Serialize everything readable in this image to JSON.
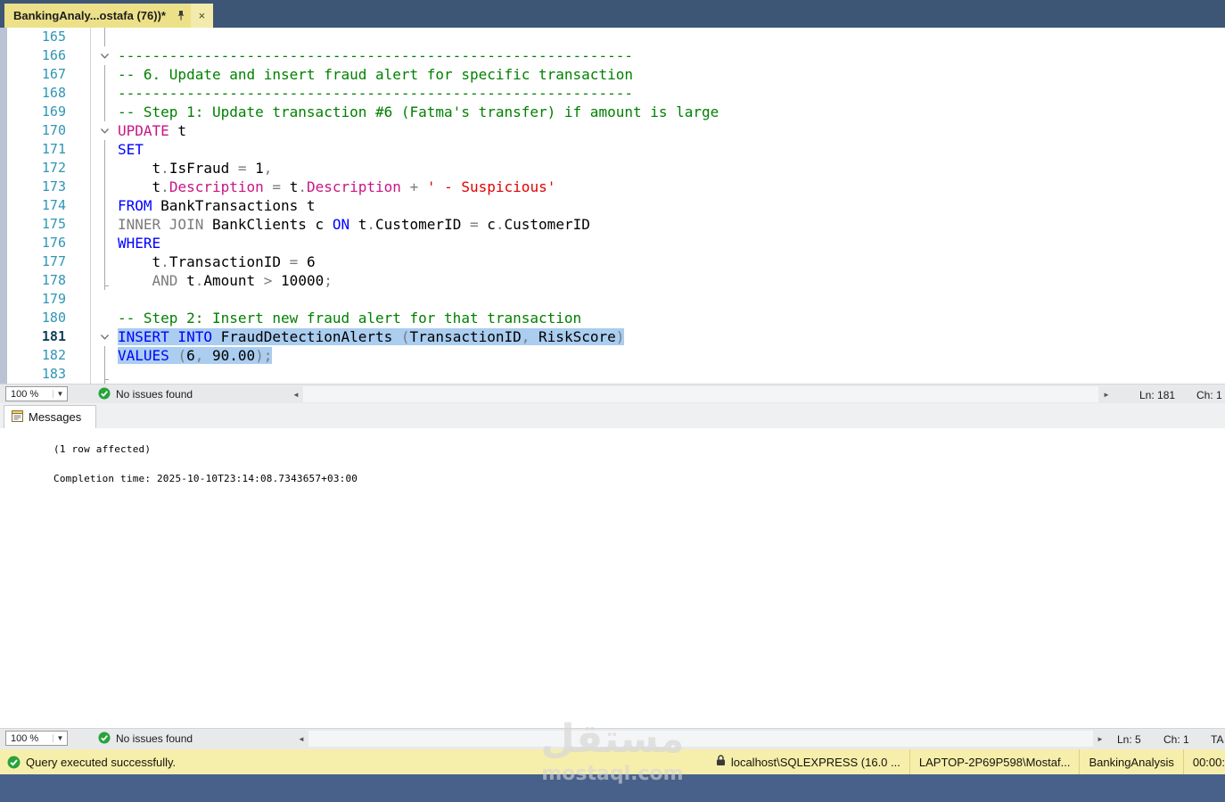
{
  "tab": {
    "title": "BankingAnaly...ostafa (76))*"
  },
  "editor": {
    "status": {
      "zoom": "100 %",
      "issues": "No issues found",
      "ln": "Ln: 181",
      "ch": "Ch: 1"
    },
    "lines": [
      {
        "n": 165,
        "fold": "guide",
        "tokens": []
      },
      {
        "n": 166,
        "fold": "open",
        "tokens": [
          {
            "c": "cm",
            "t": "------------------------------------------------------------"
          }
        ]
      },
      {
        "n": 167,
        "fold": "guide",
        "tokens": [
          {
            "c": "cm",
            "t": "-- 6. Update and insert fraud alert for specific transaction"
          }
        ]
      },
      {
        "n": 168,
        "fold": "guide",
        "tokens": [
          {
            "c": "cm",
            "t": "------------------------------------------------------------"
          }
        ]
      },
      {
        "n": 169,
        "fold": "guide",
        "tokens": [
          {
            "c": "cm",
            "t": "-- Step 1: Update transaction #6 (Fatma's transfer) if amount is large"
          }
        ]
      },
      {
        "n": 170,
        "fold": "open",
        "tokens": [
          {
            "c": "fn",
            "t": "UPDATE"
          },
          {
            "c": "id",
            "t": " t"
          }
        ]
      },
      {
        "n": 171,
        "fold": "guide",
        "tokens": [
          {
            "c": "kw",
            "t": "SET"
          }
        ]
      },
      {
        "n": 172,
        "fold": "guide",
        "tokens": [
          {
            "c": "id",
            "t": "    t"
          },
          {
            "c": "op",
            "t": "."
          },
          {
            "c": "id",
            "t": "IsFraud "
          },
          {
            "c": "op",
            "t": "= "
          },
          {
            "c": "id",
            "t": "1"
          },
          {
            "c": "op",
            "t": ","
          }
        ]
      },
      {
        "n": 173,
        "fold": "guide",
        "tokens": [
          {
            "c": "id",
            "t": "    t"
          },
          {
            "c": "op",
            "t": "."
          },
          {
            "c": "fn",
            "t": "Description"
          },
          {
            "c": "op",
            "t": " = "
          },
          {
            "c": "id",
            "t": "t"
          },
          {
            "c": "op",
            "t": "."
          },
          {
            "c": "fn",
            "t": "Description"
          },
          {
            "c": "op",
            "t": " + "
          },
          {
            "c": "st",
            "t": "' - Suspicious'"
          }
        ]
      },
      {
        "n": 174,
        "fold": "guide",
        "tokens": [
          {
            "c": "kw",
            "t": "FROM"
          },
          {
            "c": "id",
            "t": " BankTransactions t"
          }
        ]
      },
      {
        "n": 175,
        "fold": "guide",
        "tokens": [
          {
            "c": "op",
            "t": "INNER JOIN"
          },
          {
            "c": "id",
            "t": " BankClients c "
          },
          {
            "c": "kw",
            "t": "ON"
          },
          {
            "c": "id",
            "t": " t"
          },
          {
            "c": "op",
            "t": "."
          },
          {
            "c": "id",
            "t": "CustomerID "
          },
          {
            "c": "op",
            "t": "= "
          },
          {
            "c": "id",
            "t": "c"
          },
          {
            "c": "op",
            "t": "."
          },
          {
            "c": "id",
            "t": "CustomerID"
          }
        ]
      },
      {
        "n": 176,
        "fold": "guide",
        "tokens": [
          {
            "c": "kw",
            "t": "WHERE"
          }
        ]
      },
      {
        "n": 177,
        "fold": "guide",
        "tokens": [
          {
            "c": "id",
            "t": "    t"
          },
          {
            "c": "op",
            "t": "."
          },
          {
            "c": "id",
            "t": "TransactionID "
          },
          {
            "c": "op",
            "t": "= "
          },
          {
            "c": "id",
            "t": "6"
          }
        ]
      },
      {
        "n": 178,
        "fold": "end",
        "tokens": [
          {
            "c": "op",
            "t": "    AND"
          },
          {
            "c": "id",
            "t": " t"
          },
          {
            "c": "op",
            "t": "."
          },
          {
            "c": "id",
            "t": "Amount "
          },
          {
            "c": "op",
            "t": "> "
          },
          {
            "c": "id",
            "t": "10000"
          },
          {
            "c": "op",
            "t": ";"
          }
        ]
      },
      {
        "n": 179,
        "fold": "",
        "tokens": []
      },
      {
        "n": 180,
        "fold": "",
        "tokens": [
          {
            "c": "cm",
            "t": "-- Step 2: Insert new fraud alert for that transaction"
          }
        ]
      },
      {
        "n": 181,
        "fold": "open",
        "cur": true,
        "sel": true,
        "tokens": [
          {
            "c": "kw",
            "t": "INSERT INTO"
          },
          {
            "c": "id",
            "t": " FraudDetectionAlerts "
          },
          {
            "c": "op",
            "t": "("
          },
          {
            "c": "id",
            "t": "TransactionID"
          },
          {
            "c": "op",
            "t": ","
          },
          {
            "c": "id",
            "t": " RiskScore"
          },
          {
            "c": "op",
            "t": ")"
          }
        ]
      },
      {
        "n": 182,
        "fold": "guide",
        "sel": true,
        "tokens": [
          {
            "c": "kw",
            "t": "VALUES"
          },
          {
            "c": "id",
            "t": " "
          },
          {
            "c": "op",
            "t": "("
          },
          {
            "c": "id",
            "t": "6"
          },
          {
            "c": "op",
            "t": ","
          },
          {
            "c": "id",
            "t": " 90.00"
          },
          {
            "c": "op",
            "t": ");"
          }
        ]
      },
      {
        "n": 183,
        "fold": "end",
        "tokens": []
      }
    ]
  },
  "messages": {
    "tab": "Messages",
    "lines": [
      "(1 row affected)",
      "",
      "Completion time: 2025-10-10T23:14:08.7343657+03:00"
    ],
    "status": {
      "zoom": "100 %",
      "issues": "No issues found",
      "ln": "Ln: 5",
      "ch": "Ch: 1",
      "ta": "TA"
    }
  },
  "querybar": {
    "message": "Query executed successfully.",
    "server": "localhost\\SQLEXPRESS (16.0 ...",
    "user": "LAPTOP-2P69P598\\Mostaf...",
    "database": "BankingAnalysis",
    "elapsed": "00:00:"
  },
  "watermark": {
    "line1": "مستقل",
    "line2": "mostaql.com"
  },
  "colors": {
    "titlebar": "#3d5675",
    "tab_active": "#ece189",
    "selection": "#aacdf0",
    "keyword": "#0000ff",
    "comment": "#008000",
    "operator": "#7b7b7b",
    "string": "#e00000",
    "system_function": "#c71585",
    "line_number": "#2e96b5",
    "status_bg": "#e7e9eb",
    "query_bar_bg": "#f6eeab",
    "success_green": "#27a33b"
  }
}
